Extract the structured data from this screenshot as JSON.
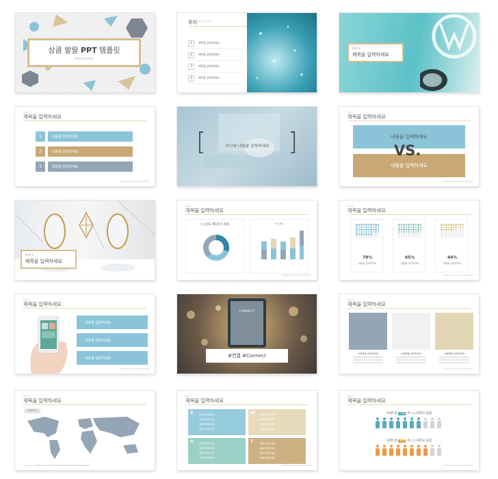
{
  "slide1": {
    "title_pre": "상큼 발랄",
    "title_bold": "PPT",
    "title_post": "템플릿",
    "subtitle": "예쁘자 피피티닷컴"
  },
  "slide2": {
    "title": "목차",
    "subtitle": "content of contents",
    "items": [
      {
        "num": "1",
        "label": "제목을 입력하세요"
      },
      {
        "num": "2",
        "label": "제목을 입력하세요"
      },
      {
        "num": "3",
        "label": "제목을 입력하세요"
      },
      {
        "num": "4",
        "label": "제목을 입력하세요"
      }
    ]
  },
  "slide3": {
    "part": "Part 1.",
    "title": "제목을 입력하세요"
  },
  "slide4": {
    "tag": "Part 1",
    "title": "제목을 입력하세요",
    "footer": "Slidesppt / slidesppt.com/Part/Part",
    "rows": [
      {
        "num": "1",
        "label": "내용을 입력하세요"
      },
      {
        "num": "2",
        "label": "내용을 입력하세요"
      },
      {
        "num": "3",
        "label": "내용을 입력하세요"
      }
    ]
  },
  "slide5": {
    "open": "[",
    "close": "]",
    "text": "여기에 내용을 입력하세요"
  },
  "slide6": {
    "tag": "Part 1",
    "title": "제목을 입력하세요",
    "top": "내용을 입력하세요",
    "vs": "VS.",
    "bottom": "내용을 입력하세요",
    "footer": "Slidesppt / slidesppt.com/Part/Part"
  },
  "slide7": {
    "part": "Part 2.",
    "title": "제목을 입력하세요"
  },
  "slide8": {
    "tag": "Part 2",
    "title": "제목을 입력하세요",
    "donut_title": "○○년도 제1분기 실적",
    "bar_title": "차트 제목",
    "footer": "Slidesppt / slidesppt.com/Part/Part"
  },
  "slide9": {
    "tag": "Part 2",
    "title": "제목을 입력하세요",
    "footer": "Slidesppt / slidesppt.com/Part/Part",
    "stats": [
      {
        "pct": "78%",
        "label": "내용을 입력하세요",
        "color": "#8bc4d9",
        "fill": 0.78
      },
      {
        "pct": "65%",
        "label": "내용을 입력하세요",
        "color": "#8fcbbf",
        "fill": 0.65
      },
      {
        "pct": "44%",
        "label": "내용을 입력하세요",
        "color": "#e1c58f",
        "fill": 0.44
      }
    ]
  },
  "slide10": {
    "tag": "Part 3",
    "title": "제목을 입력하세요",
    "footer": "Slidesppt / slidesppt.com/Part/Part",
    "items": [
      "내용을 입력하세요",
      "내용을 입력하세요",
      "내용을 입력하세요"
    ]
  },
  "slide11": {
    "caption": "#연결 #Connect",
    "screen_text": "CONNECT"
  },
  "slide12": {
    "tag": "Part 3",
    "title": "제목을 입력하세요",
    "footer": "Slidesppt / slidesppt.com/Part/Part",
    "cols": [
      {
        "label": "소제목을 입력하세요",
        "color": "#94a5b5"
      },
      {
        "label": "소제목을 입력하세요",
        "color": "#f1f1f1"
      },
      {
        "label": "소제목을 입력하세요",
        "color": "#e3d6b4"
      }
    ]
  },
  "slide13": {
    "tag": "Part 4",
    "title": "제목을 입력하세요",
    "chip": "세계지도",
    "footer": "지도 출처: © Simplemaps.com / https://simplemaps.com/resources/svg-maps"
  },
  "slide14": {
    "tag": "Part 4",
    "title": "제목을 입력하세요",
    "footer": "Slidesppt / slidesppt.com/Part/Part",
    "quads": [
      {
        "letter": "S",
        "color": "#8bc4d9"
      },
      {
        "letter": "W",
        "color": "#e3d6b4"
      },
      {
        "letter": "O",
        "color": "#8fcbbf"
      },
      {
        "letter": "T",
        "color": "#c9a875"
      }
    ],
    "line": "내용을 입력하세요"
  },
  "slide15": {
    "tag": "Part 4",
    "title": "제목을 입력하세요",
    "footer": "Slidesppt / slidesppt.com/Part/Part",
    "rows": [
      {
        "pre": "10명 중",
        "hl": "7명",
        "post": "이 ○○하라고 응답",
        "color": "#5aa9bd",
        "fill": 7
      },
      {
        "pre": "10명 중",
        "hl": "8명",
        "post": "이 ○○하라고 응답",
        "color": "#ec9a45",
        "fill": 8
      }
    ]
  }
}
